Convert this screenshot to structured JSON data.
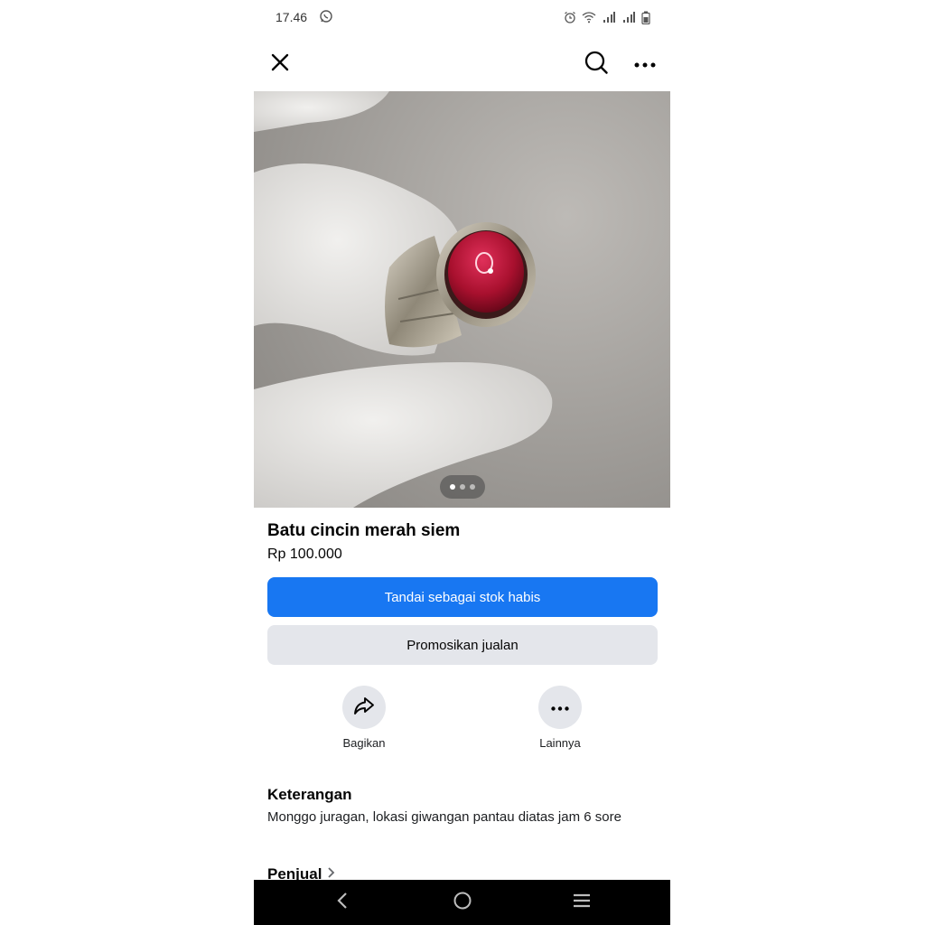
{
  "status_bar": {
    "time": "17.46",
    "icons": [
      "whatsapp-icon",
      "alarm-icon",
      "wifi-icon",
      "signal-icon",
      "signal-icon",
      "battery-icon"
    ]
  },
  "top_bar": {
    "icons": [
      "close-icon",
      "search-icon",
      "more-horizontal-icon"
    ]
  },
  "photo": {
    "description_icon": "product-photo",
    "page_count": 3,
    "current_page": 1
  },
  "product": {
    "title": "Batu cincin merah siem",
    "price": "Rp 100.000"
  },
  "buttons": {
    "mark_sold": "Tandai sebagai stok habis",
    "promote": "Promosikan jualan"
  },
  "actions": [
    {
      "label": "Bagikan",
      "icon": "share-icon"
    },
    {
      "label": "Lainnya",
      "icon": "more-horizontal-icon"
    }
  ],
  "description": {
    "heading": "Keterangan",
    "text": "Monggo juragan, lokasi giwangan pantau diatas jam 6 sore"
  },
  "seller": {
    "label": "Penjual",
    "icon": "chevron-right-icon"
  },
  "nav_bar": {
    "icons": [
      "back-icon",
      "home-icon",
      "recents-icon"
    ]
  },
  "colors": {
    "primary": "#1877f2",
    "secondary_button": "#e4e6eb",
    "nav_bar": "#000000"
  }
}
